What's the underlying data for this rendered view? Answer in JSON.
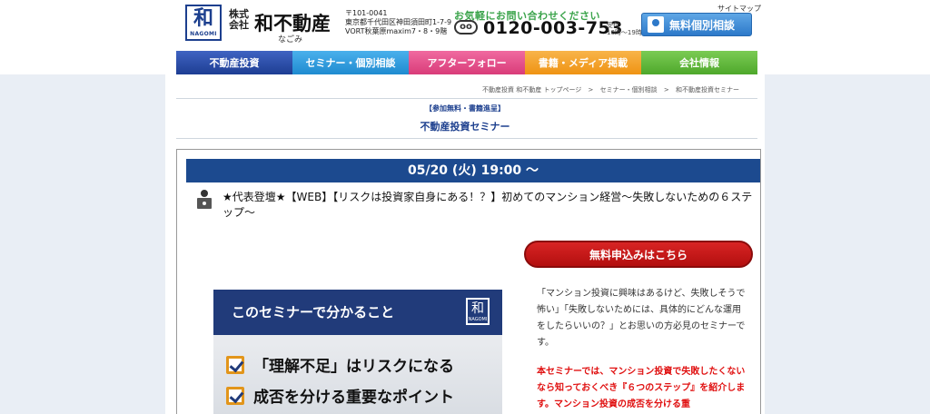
{
  "header": {
    "logo_text": "和",
    "logo_sub": "NAGOMI",
    "corp_type": "株式会社",
    "brand_name": "和不動産",
    "brand_kana": "なごみ",
    "address_lines": [
      "〒101-0041",
      "東京都千代田区神田須田町1-7-9",
      "VORT秋葉原maxim7・8・9階"
    ],
    "contact_lead": "お気軽にお問い合わせください",
    "freedial_label": "oo",
    "phone": "0120-003-753",
    "hours_lines": [
      "受付",
      "10時～19時"
    ],
    "sitemap": "サイトマップ",
    "cta_label": "無料個別相談"
  },
  "nav": {
    "items": [
      "不動産投資",
      "セミナー・個別相談",
      "アフターフォロー",
      "書籍・メディア掲載",
      "会社情報"
    ]
  },
  "breadcrumb": {
    "items": [
      "不動産投資 和不動産 トップページ",
      "セミナー・個別相談",
      "和不動産投資セミナー"
    ],
    "separator": ">"
  },
  "main": {
    "tagline": "【参加無料・書籍進呈】",
    "page_title": "不動産投資セミナー"
  },
  "event": {
    "date": "05/20 (火) 19:00 ～",
    "title": "★代表登壇★【WEB】【リスクは投資家自身にある！？】初めてのマンション経営～失敗しないための６ステップ～",
    "apply_label": "無料申込みはこちら",
    "description": "「マンション投資に興味はあるけど、失敗しそうで怖い」「失敗しないためには、具体的にどんな運用をしたらいいの？」とお思いの方必見のセミナーです。",
    "highlight": "本セミナーでは、マンション投資で失敗したくないなら知っておくべき『６つのステップ』を紹介します。マンション投資の成否を分ける重"
  },
  "banner": {
    "heading": "このセミナーで分かること",
    "logo_text": "和",
    "logo_sub": "NAGOMI",
    "points": [
      "「理解不足」はリスクになる",
      "成否を分ける重要なポイント"
    ]
  },
  "colors": {
    "brand_navy": "#1c4a8f",
    "apply_red": "#c41a1a",
    "highlight_red": "#e01010",
    "accent_green": "#3aa34a",
    "cta_blue": "#2d79c9"
  }
}
